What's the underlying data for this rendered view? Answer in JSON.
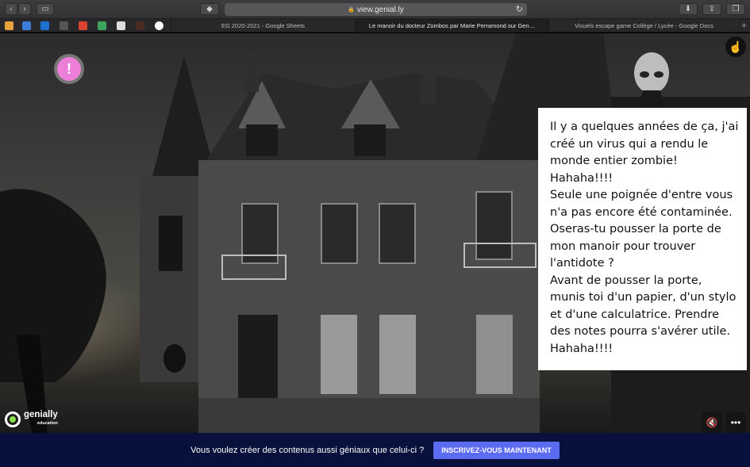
{
  "browser": {
    "url": "view.genial.ly",
    "tabs": [
      {
        "label": "EG 2020-2021 - Google Sheets",
        "active": false
      },
      {
        "label": "Le manoir du docteur Zombos par Marie Perramond sur Gen…",
        "active": true
      },
      {
        "label": "Visuels escape game Collège / Lycée - Google Docs",
        "active": false
      }
    ],
    "new_tab": "+"
  },
  "scene": {
    "alert_symbol": "!",
    "speech": [
      "Il y a quelques années de ça, j'ai créé un virus qui a rendu le monde entier zombie! Hahaha!!!!",
      "Seule une poignée d'entre vous n'a pas encore été contaminée. Oseras-tu pousser la porte de mon manoir pour trouver l'antidote ?",
      "Avant de pousser la porte, munis toi d'un papier, d'un stylo et d'une calculatrice. Prendre des notes pourra s'avérer utile. Hahaha!!!!"
    ],
    "logo": {
      "name": "genially",
      "sub": "education"
    }
  },
  "footer": {
    "text": "Vous voulez créer des contenus aussi géniaux que celui-ci ?",
    "cta": "INSCRIVEZ-VOUS MAINTENANT"
  },
  "colors": {
    "alert": "#ee7fd9",
    "footer_bg": "#07113b",
    "cta": "#5b6bf2"
  }
}
